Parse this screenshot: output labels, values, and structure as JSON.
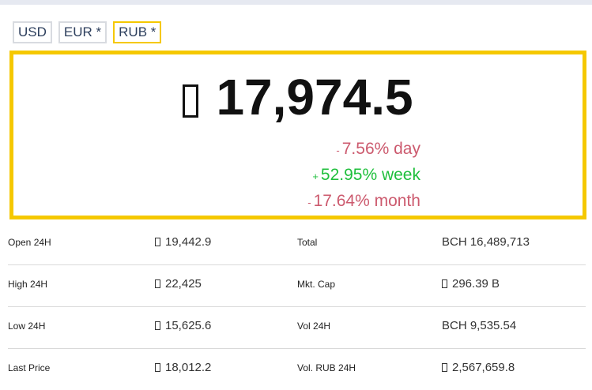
{
  "currency_tabs": [
    {
      "label": "USD",
      "active": false
    },
    {
      "label": "EUR *",
      "active": false
    },
    {
      "label": "RUB *",
      "active": true
    }
  ],
  "price": {
    "currency_icon": "ruble-sign-icon",
    "value": "17,974.5"
  },
  "changes": [
    {
      "sign": "-",
      "text": "7.56% day",
      "direction": "negative"
    },
    {
      "sign": "+",
      "text": "52.95% week",
      "direction": "positive"
    },
    {
      "sign": "-",
      "text": "17.64% month",
      "direction": "negative"
    }
  ],
  "stats": [
    {
      "label1": "Open 24H",
      "value1": "19,442.9",
      "label2": "Total",
      "value2": "BCH 16,489,713"
    },
    {
      "label1": "High 24H",
      "value1": "22,425",
      "label2": "Mkt. Cap",
      "value2": "296.39 B"
    },
    {
      "label1": "Low 24H",
      "value1": "15,625.6",
      "label2": "Vol 24H",
      "value2": "BCH 9,535.54"
    },
    {
      "label1": "Last Price",
      "value1": "18,012.2",
      "label2": "Vol. RUB 24H",
      "value2": "2,567,659.8"
    }
  ],
  "colors": {
    "accent": "#f5c800",
    "negative": "#cc5a6e",
    "positive": "#1fbf3c"
  }
}
